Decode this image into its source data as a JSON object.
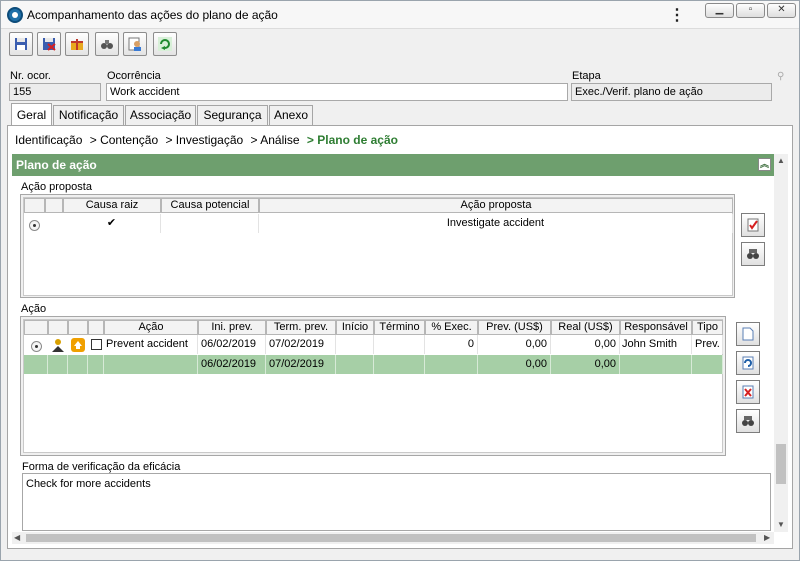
{
  "window": {
    "title": "Acompanhamento das ações do plano de ação",
    "menu_icon": "kebab-icon",
    "controls": [
      "minimize",
      "maximize",
      "close"
    ]
  },
  "toolbar": {
    "buttons": [
      "save-icon",
      "save-close-icon",
      "gift-icon",
      "binoculars-user-icon",
      "user-document-icon",
      "refresh-icon"
    ]
  },
  "header": {
    "nr_label": "Nr. ocor.",
    "nr_value": "155",
    "occ_label": "Ocorrência",
    "occ_value": "Work accident",
    "stage_label": "Etapa",
    "stage_value": "Exec./Verif. plano de ação"
  },
  "tabs": [
    {
      "label": "Geral",
      "active": true
    },
    {
      "label": "Notificação",
      "active": false
    },
    {
      "label": "Associação",
      "active": false
    },
    {
      "label": "Segurança",
      "active": false
    },
    {
      "label": "Anexo",
      "active": false
    }
  ],
  "breadcrumb": {
    "items": [
      "Identificação",
      "> Contenção",
      "> Investigação",
      "> Análise"
    ],
    "current": "> Plano de ação"
  },
  "panel": {
    "title": "Plano de ação",
    "collapse_icon": "double-chevron-up-icon"
  },
  "proposed": {
    "label": "Ação proposta",
    "columns": [
      "",
      "",
      "Causa raiz",
      "Causa potencial",
      "Ação proposta"
    ],
    "rows": [
      {
        "causa_raiz": "✔",
        "causa_potencial": "",
        "acao": "Investigate accident"
      }
    ]
  },
  "actions": {
    "label": "Ação",
    "columns": [
      "",
      "",
      "",
      "",
      "Ação",
      "Ini. prev.",
      "Term. prev.",
      "Início",
      "Término",
      "% Exec.",
      "Prev. (US$)",
      "Real (US$)",
      "Responsável",
      "Tipo"
    ],
    "rows": [
      {
        "acao": "Prevent accident",
        "ini_prev": "06/02/2019",
        "term_prev": "07/02/2019",
        "inicio": "",
        "termino": "",
        "exec": "0",
        "prev": "0,00",
        "real": "0,00",
        "resp": "John Smith",
        "tipo": "Prev."
      },
      {
        "acao": "",
        "ini_prev": "06/02/2019",
        "term_prev": "07/02/2019",
        "inicio": "",
        "termino": "",
        "exec": "",
        "prev": "0,00",
        "real": "0,00",
        "resp": "",
        "tipo": ""
      }
    ]
  },
  "verification": {
    "label": "Forma de verificação da eficácia",
    "value": "Check for more accidents"
  },
  "colors": {
    "panel_header": "#6e9f6e",
    "selected_row": "#a6cfa6",
    "breadcrumb_current": "#2e7d32"
  }
}
